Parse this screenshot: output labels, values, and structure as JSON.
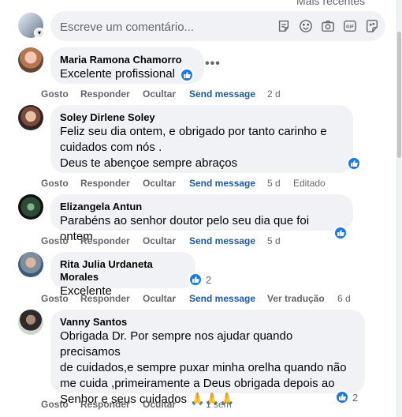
{
  "header": {
    "sort_label": "Mais recentes"
  },
  "composer": {
    "placeholder": "Escreve um comentário...",
    "tools": [
      "sticker-icon",
      "emoji-icon",
      "camera-icon",
      "gif-icon",
      "avatar-sticker-icon"
    ]
  },
  "comments": [
    {
      "author": "Maria Ramona Chamorro",
      "lines": [
        "Excelente profissional"
      ],
      "reactions": {
        "icon": "like-icon",
        "count": ""
      },
      "actions": {
        "like": "Gosto",
        "reply": "Responder",
        "hide": "Ocultar",
        "message": "Send message",
        "time": "2 d",
        "extra": ""
      }
    },
    {
      "author": "Soley Dirlene Soley",
      "lines": [
        "Feliz seu dia ontem, e obrigado por tanto carinho e",
        "cuidados com nós .",
        "Deus te abençoe sempre abraços"
      ],
      "reactions": {
        "icon": "like-icon",
        "count": ""
      },
      "actions": {
        "like": "Gosto",
        "reply": "Responder",
        "hide": "Ocultar",
        "message": "Send message",
        "time": "5 d",
        "extra": "Editado"
      }
    },
    {
      "author": "Elizangela Antun",
      "lines": [
        "Parabéns ao senhor doutor pelo seu dia que foi ontem"
      ],
      "reactions": {
        "icon": "like-icon",
        "count": ""
      },
      "actions": {
        "like": "Gosto",
        "reply": "Responder",
        "hide": "Ocultar",
        "message": "Send message",
        "time": "5 d",
        "extra": ""
      }
    },
    {
      "author": "Rita Julia Urdaneta Morales",
      "lines": [
        "Excelente"
      ],
      "reactions": {
        "icon": "like-icon",
        "count": "2"
      },
      "actions": {
        "like": "Gosto",
        "reply": "Responder",
        "hide": "Ocultar",
        "message": "Send message",
        "time": "6 d",
        "extra": "Ver tradução"
      }
    },
    {
      "author": "Vanny Santos",
      "lines": [
        "Obrigada Dr. Por sempre nos ajudar quando precisamos",
        "de cuidados,e sempre puxar minha orelha quando não",
        "me cuida ,primeiramente a Deus obrigada depois ao",
        "Senhor e seus cuidados 🙏🙏🙏"
      ],
      "reactions": {
        "icon": "like-icon",
        "count": "2"
      },
      "actions": {
        "like": "Gosto",
        "reply": "Responder",
        "hide": "Ocultar",
        "message": "",
        "time": "1 sem",
        "extra": ""
      }
    }
  ],
  "colors": {
    "bubble": "#f0f2f5",
    "like": "#1877f2",
    "link": "#1c5aa8",
    "muted": "#65676b"
  }
}
